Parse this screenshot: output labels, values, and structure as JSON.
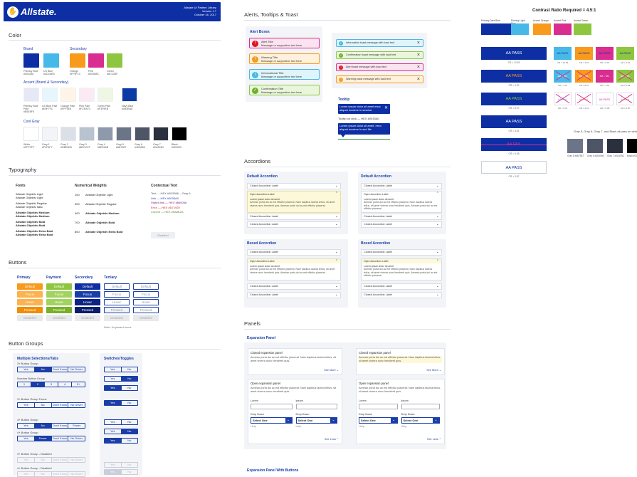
{
  "header": {
    "logo": "Allstate.",
    "library_title": "Allstate UI Pattern Library",
    "version": "Version 1.7",
    "date": "October 16, 2017"
  },
  "color": {
    "title": "Color",
    "brand_label": "Brand",
    "secondary_label": "Secondary",
    "accent_label": "Accent (Brand & Secondary)",
    "cool_gray_label": "Cool Gray",
    "brand": [
      {
        "name": "Primary Blue #0033A0",
        "hex": "#0d2fa3"
      },
      {
        "name": "UX Blue #4DC8E8",
        "hex": "#46b9e8"
      }
    ],
    "secondary": [
      {
        "name": "Orange #FF9F1C",
        "hex": "#f89a1c"
      },
      {
        "name": "Pink #E0308C",
        "hex": "#d92d8f"
      },
      {
        "name": "Green #8CC63F",
        "hex": "#8ec73f"
      }
    ],
    "accent": [
      {
        "name": "Primary Blue Pale #E6E8F5",
        "hex": "#e6e8f5"
      },
      {
        "name": "UX Blue Pale #E9F7FC",
        "hex": "#e6f6fc"
      },
      {
        "name": "Orange Pale #FFF5E8",
        "hex": "#fff4e6"
      },
      {
        "name": "Pink Pale #FCEAF4",
        "hex": "#fbeaf3"
      },
      {
        "name": "Green Pale #F3F9EB",
        "hex": "#eef7e3"
      },
      {
        "name": "Navy Blue #0B3BA8",
        "hex": "#0d3ba6"
      }
    ],
    "gray": [
      {
        "name": "White #FFFFFF",
        "hex": "#ffffff"
      },
      {
        "name": "Gray 1 #F2F4F7",
        "hex": "#f2f4f7"
      },
      {
        "name": "Gray 2 #DBE0E8",
        "hex": "#dbe0e8"
      },
      {
        "name": "Gray 3 #B9C2CF",
        "hex": "#b9c2cf"
      },
      {
        "name": "Gray 4 #8E99AB",
        "hex": "#8e99ab"
      },
      {
        "name": "Gray 5 #6B7587",
        "hex": "#6b7587"
      },
      {
        "name": "Gray 6 #4D5566",
        "hex": "#4d5566"
      },
      {
        "name": "Gray 7 #2A303D",
        "hex": "#2a303d"
      },
      {
        "name": "Black #000000",
        "hex": "#000000"
      }
    ]
  },
  "typography": {
    "title": "Typography",
    "fonts_label": "Fonts",
    "weights_label": "Numerical Weights",
    "contextual_label": "Contextual Text",
    "fonts": [
      "Allstate Objektiv Light\nAllstate Objektiv Light",
      "Allstate Objektiv Regular\nAllstate Objektiv Italic",
      "Allstate Objektiv Medium\nAllstate Objektiv Medium",
      "Allstate Objektiv Bold\nAllstate Objektiv Bold",
      "Allstate Objektiv Extra Bold\nAllstate Objektiv Extra Bold"
    ],
    "weights": [
      {
        "num": "100",
        "name": "Allstate Objektiv Light"
      },
      {
        "num": "300",
        "name": "Allstate Objektiv Regular"
      },
      {
        "num": "400",
        "name": "Allstate Objektiv Medium"
      },
      {
        "num": "700",
        "name": "Allstate Objektiv Bold"
      },
      {
        "num": "800",
        "name": "Allstate Objektiv Extra Bold"
      }
    ],
    "contextual": [
      {
        "text": "Text — HEX #4D5566 – Gray 6",
        "color": "#4d5566"
      },
      {
        "text": "Link — HEX #0033A0",
        "color": "#1a3ea8"
      },
      {
        "text": "Visited link — HEX #660066",
        "color": "#7a1a7a"
      },
      {
        "text": "Error — HEX #D71920",
        "color": "#d71920"
      },
      {
        "text": "Correct — HEX #5A8E2A",
        "color": "#4d8b26"
      }
    ],
    "disabled": "Disabled"
  },
  "buttons": {
    "title": "Buttons",
    "cols": [
      "Primary",
      "Payment",
      "Secondary",
      "Tertiary"
    ],
    "states": [
      "Default",
      "Focus",
      "Hover",
      "Pressed",
      "Disabled"
    ],
    "note": "Note: Keyboard focus"
  },
  "button_groups": {
    "title": "Button Groups",
    "multi_title": "Multiple Selections/Tabs",
    "switch_title": "Switches/Toggles",
    "g1": "3+ Button Group",
    "g2": "Number Button Group",
    "g3": "3+ Button Group Focus",
    "g4": "4+ Button Group",
    "g5": "4+ Button Group",
    "g6": "3+ Button Group - Disabled",
    "g7": "4+ Button Group - Disabled",
    "opts4": [
      "Yes",
      "No",
      "Don't Know",
      "No Driver"
    ],
    "nums": [
      "1",
      "2",
      "3",
      "4",
      "5+"
    ],
    "opts4b": [
      "Yes",
      "No",
      "Don't Know",
      "Fewer"
    ],
    "opts4c": [
      "Yes",
      "Fewer",
      "Don't Know",
      "No Driver"
    ],
    "yes": "Yes",
    "no": "No"
  },
  "alerts": {
    "title": "Alerts, Tooltips & Toast",
    "boxes_title": "Alert Boxes",
    "alert_items": [
      {
        "title": "Alert Title",
        "body": "Message or supportive text here"
      },
      {
        "title": "Warning Title",
        "body": "Message or supportive text here"
      },
      {
        "title": "Informational Title",
        "body": "Message or supportive text here"
      },
      {
        "title": "Confirmation Title",
        "body": "Message or supportive text here"
      }
    ],
    "toasts": [
      "Information toast message with load text",
      "Confirmation toast message with load text",
      "Alert toast message with load text",
      "Warning toast message with load text"
    ],
    "tooltip_title": "Tooltip",
    "tooltip1": "Lorem ipsum dolor sit amet error aliquet maxime in sescha.",
    "tooltip2": "Tooltip on click — HEX #0033A0",
    "tooltip3": "Lorem ipsum dolor sit amet, error aliquet maxime in sed life"
  },
  "accordions": {
    "title": "Accordions",
    "default_title": "Default Accordion",
    "boxed_title": "Boxed Accordion",
    "closed": "Closed Accordion Label",
    "open": "Open Accordion Label",
    "open_body_title": "Lorem ipsum dolor sit amet",
    "open_body": "Aenean porta dui ac est efficitur placerat. Nam dapibus lacinia tellus, sit amet viverra nunc hendrerit quis. Aenean porta dui ac est efficitur placerat."
  },
  "panels": {
    "title": "Panels",
    "expansion_title": "Expansion Panel",
    "closed_title": "Closed expansion panel",
    "open_title": "Open expansion panel",
    "body": "Aenean porta dui ac est efficitur placerat. Nam dapibus lacinia tellus, sit amet viverra nunc hendrerit quis.",
    "see_more": "See More",
    "see_less": "See Less",
    "lorem": "Lorem",
    "ipsum": "Ipsum",
    "dropdown": "Drop Down",
    "select_one": "Select One",
    "help": "Help",
    "with_buttons": "Expansion Panel With Buttons"
  },
  "contrast": {
    "title": "Contrast Ratio Required = 4.5:1",
    "swatch_labels": [
      "Primary Dark Blue",
      "Primary Light Blue",
      "Accent Orange",
      "Accent Pink",
      "Accent Green"
    ],
    "swatch_hex": [
      "#0d2fa3",
      "#46b9e8",
      "#f89a1c",
      "#d92d8f",
      "#8ec73f"
    ],
    "pass": "AA PASS",
    "fail": "AA FAIL",
    "gray_note": "Gray 5, Gray 6, Gray 7, and Black all pass on white",
    "ratios": [
      "CR = 12.63",
      "CR = 4.57",
      "CR = 8.07",
      "CR = 4.61",
      "CR = 5.08",
      "CR = 3.87"
    ]
  }
}
